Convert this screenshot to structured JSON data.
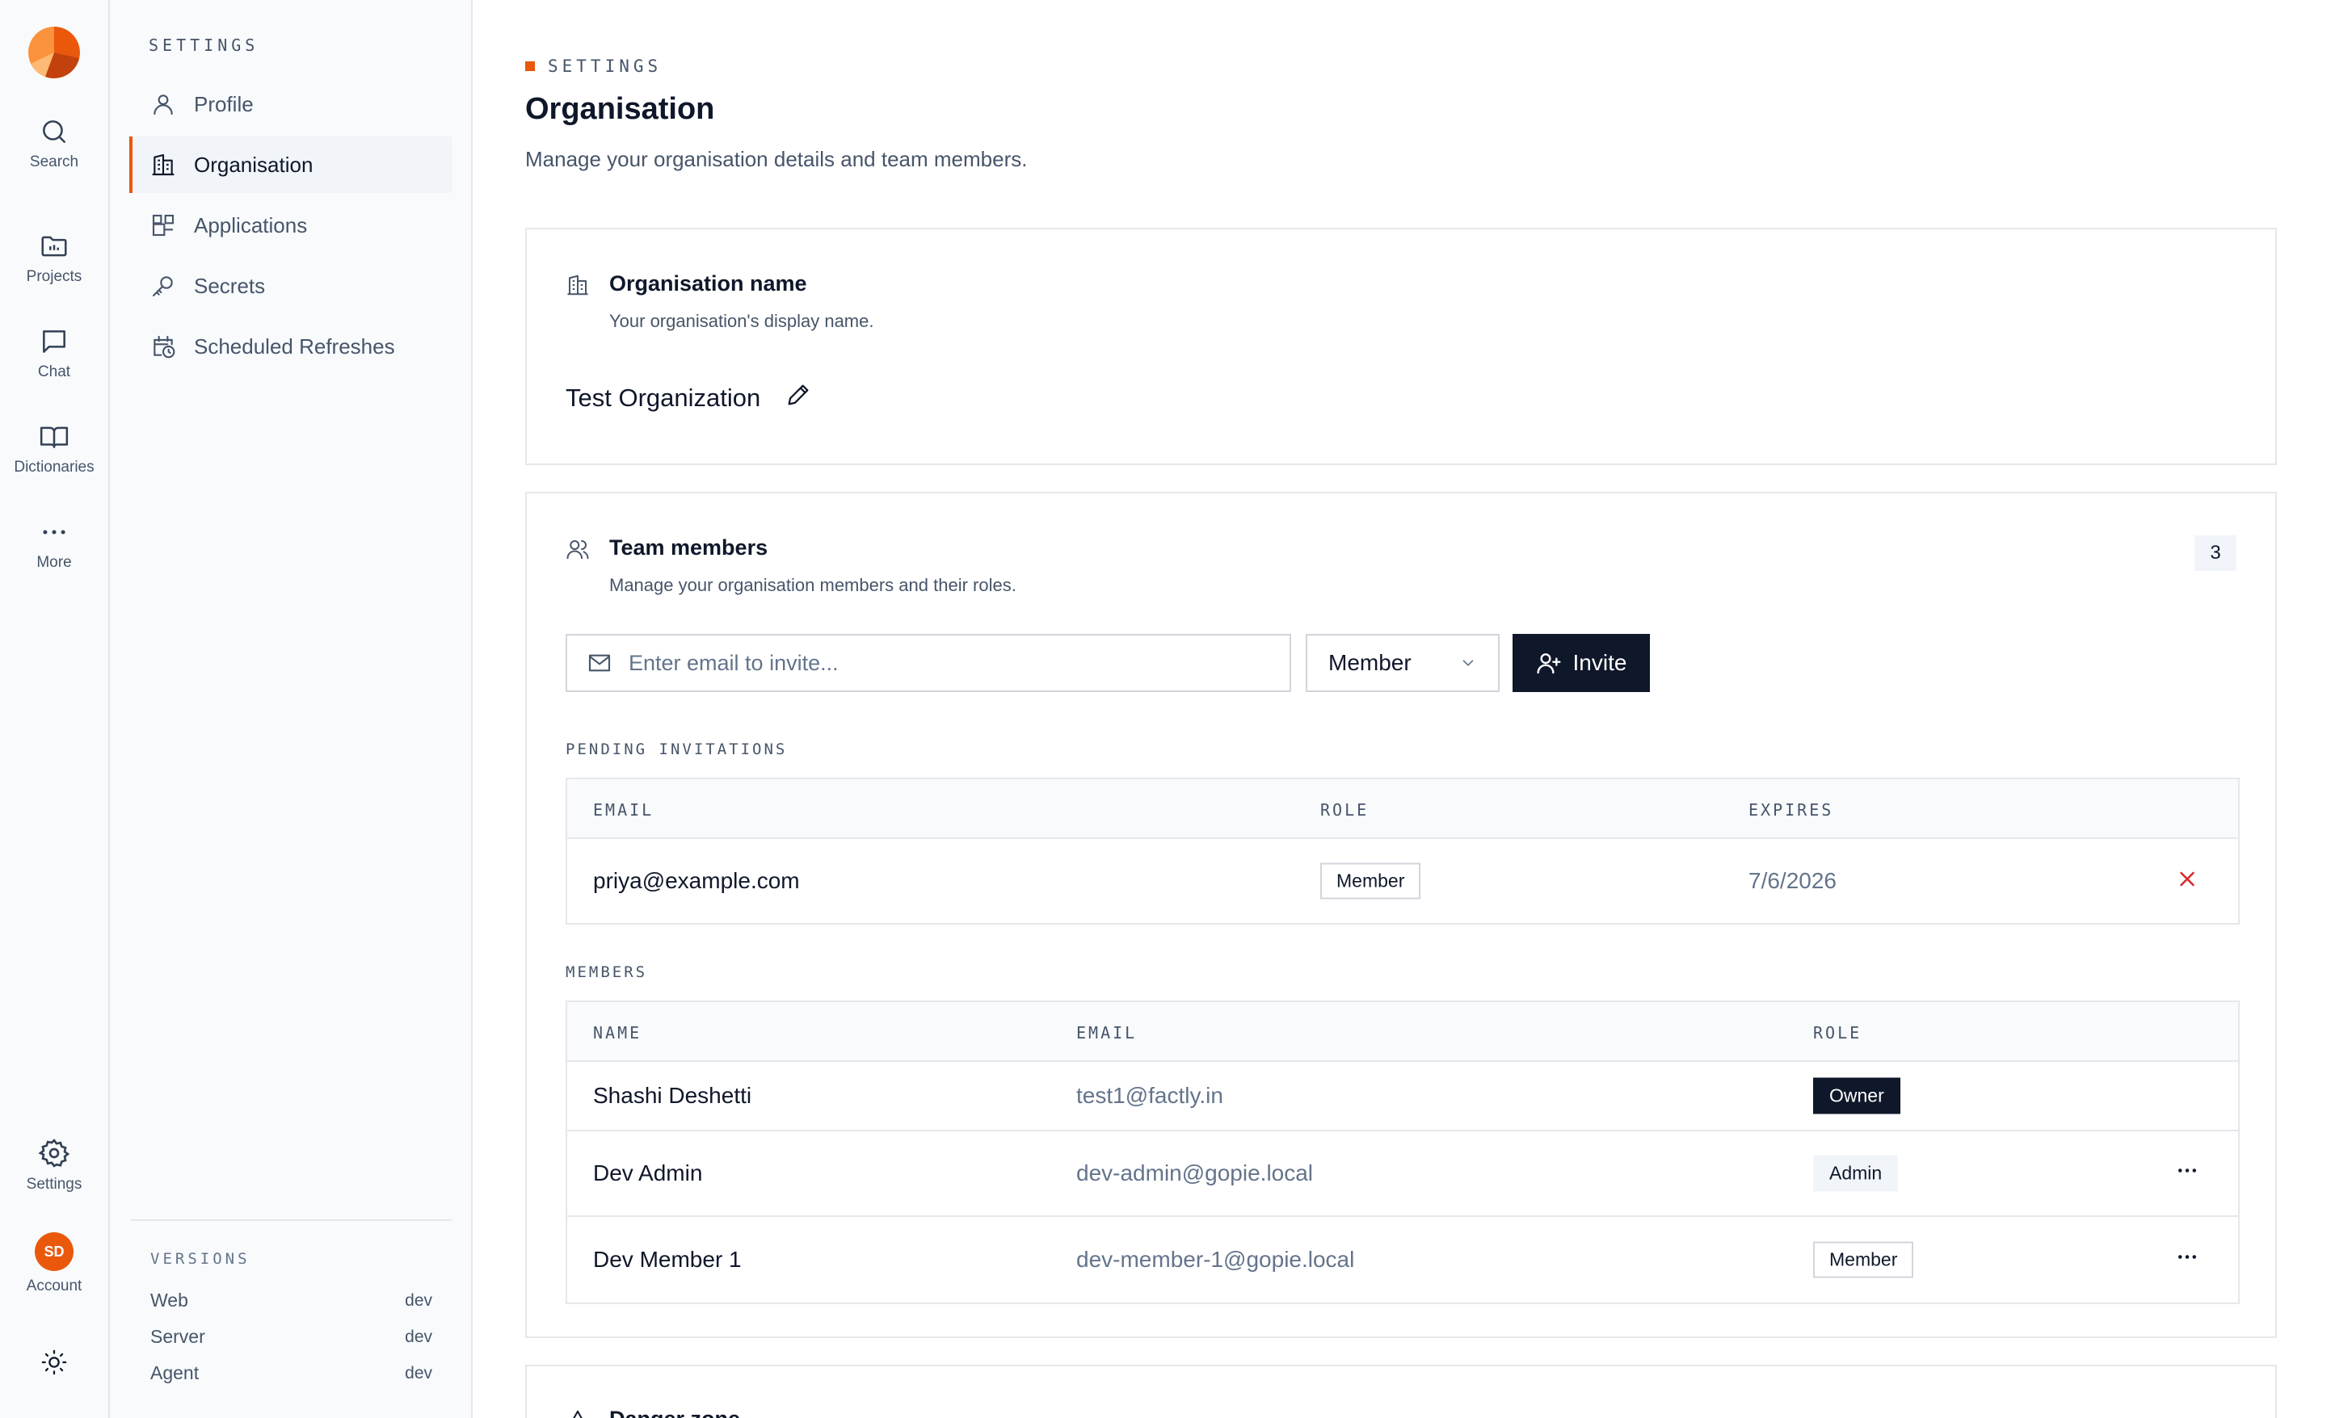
{
  "app": {
    "brand": "logo"
  },
  "rail": {
    "items": [
      {
        "label": "Search",
        "icon": "search-icon"
      },
      {
        "label": "Projects",
        "icon": "folder-icon"
      },
      {
        "label": "Chat",
        "icon": "chat-icon"
      },
      {
        "label": "Dictionaries",
        "icon": "book-icon"
      },
      {
        "label": "More",
        "icon": "more-icon"
      }
    ],
    "settings_label": "Settings",
    "account_label": "Account",
    "avatar_initials": "SD"
  },
  "sidebar": {
    "heading": "SETTINGS",
    "items": [
      {
        "label": "Profile",
        "icon": "user-icon"
      },
      {
        "label": "Organisation",
        "icon": "building-icon",
        "active": true
      },
      {
        "label": "Applications",
        "icon": "apps-icon"
      },
      {
        "label": "Secrets",
        "icon": "key-icon"
      },
      {
        "label": "Scheduled Refreshes",
        "icon": "calendar-clock-icon"
      }
    ],
    "versions": {
      "heading": "VERSIONS",
      "rows": [
        {
          "name": "Web",
          "value": "dev"
        },
        {
          "name": "Server",
          "value": "dev"
        },
        {
          "name": "Agent",
          "value": "dev"
        }
      ]
    }
  },
  "page": {
    "eyebrow": "SETTINGS",
    "title": "Organisation",
    "subtitle": "Manage your organisation details and team members."
  },
  "org_card": {
    "title": "Organisation name",
    "subtitle": "Your organisation's display name.",
    "name": "Test Organization"
  },
  "team_card": {
    "title": "Team members",
    "subtitle": "Manage your organisation members and their roles.",
    "count": "3",
    "invite": {
      "placeholder": "Enter email to invite...",
      "role": "Member",
      "button": "Invite"
    },
    "pending": {
      "label": "PENDING INVITATIONS",
      "headers": [
        "EMAIL",
        "ROLE",
        "EXPIRES"
      ],
      "rows": [
        {
          "email": "priya@example.com",
          "role": "Member",
          "expires": "7/6/2026"
        }
      ]
    },
    "members": {
      "label": "MEMBERS",
      "headers": [
        "NAME",
        "EMAIL",
        "ROLE"
      ],
      "rows": [
        {
          "name": "Shashi Deshetti",
          "email": "test1@factly.in",
          "role": "Owner"
        },
        {
          "name": "Dev Admin",
          "email": "dev-admin@gopie.local",
          "role": "Admin"
        },
        {
          "name": "Dev Member 1",
          "email": "dev-member-1@gopie.local",
          "role": "Member"
        }
      ]
    }
  },
  "danger_card": {
    "title": "Danger zone"
  },
  "colors": {
    "accent": "#ea580c",
    "primary": "#0f172a",
    "danger": "#dc2626"
  }
}
